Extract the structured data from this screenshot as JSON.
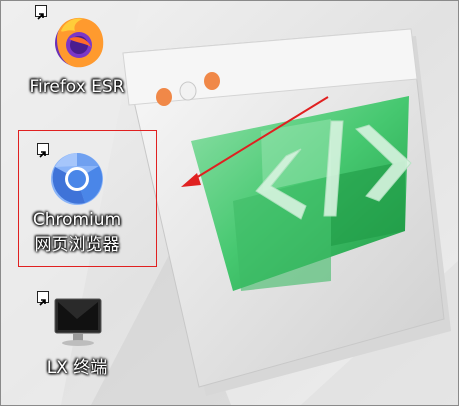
{
  "desktop": {
    "icons": [
      {
        "name": "firefox",
        "label": "Firefox ESR",
        "icon": "firefox-icon",
        "shortcut": true
      },
      {
        "name": "chromium",
        "label_line1": "Chromium",
        "label_line2": "网页浏览器",
        "icon": "chromium-icon",
        "shortcut": true,
        "highlighted": true
      },
      {
        "name": "terminal",
        "label": "LX 终端",
        "icon": "terminal-icon",
        "shortcut": true
      }
    ]
  },
  "annotation": {
    "box_color": "#e02020",
    "arrow_color": "#e02020"
  },
  "colors": {
    "wallpaper_green": "#3fc46a",
    "wallpaper_dark_green": "#24a24c",
    "chromium_blue": "#4a86e8"
  }
}
